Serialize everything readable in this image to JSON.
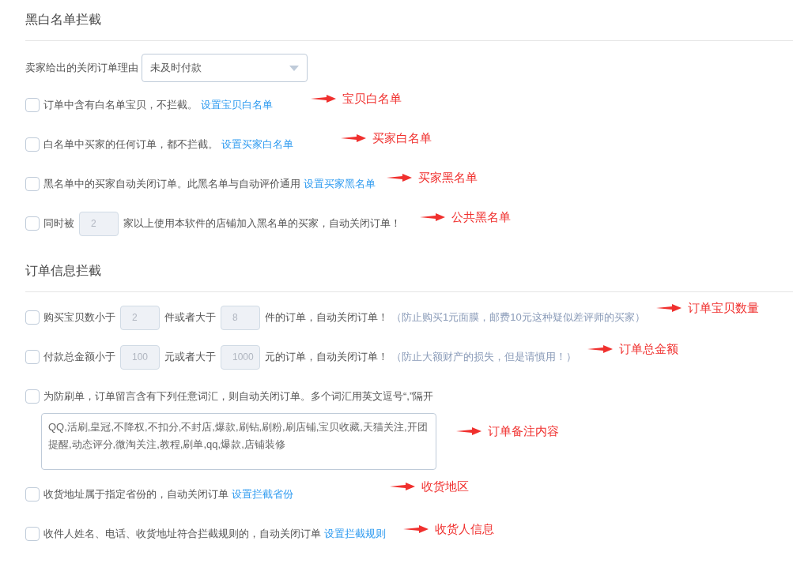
{
  "sections": [
    {
      "title": "黑白名单拦截",
      "reason_select": {
        "label": "卖家给出的关闭订单理由",
        "value": "未及时付款"
      },
      "rows": [
        {
          "checked": false,
          "parts": [
            {
              "kind": "text",
              "text": "订单中含有白名单宝贝，不拦截。"
            },
            {
              "kind": "link",
              "text": "设置宝贝白名单"
            }
          ],
          "annotation": "宝贝白名单"
        },
        {
          "checked": false,
          "parts": [
            {
              "kind": "text",
              "text": "白名单中买家的任何订单，都不拦截。"
            },
            {
              "kind": "link",
              "text": "设置买家白名单"
            }
          ],
          "annotation": "买家白名单"
        },
        {
          "checked": false,
          "parts": [
            {
              "kind": "text",
              "text": "黑名单中的买家自动关闭订单。此黑名单与自动评价通用"
            },
            {
              "kind": "link",
              "text": "设置买家黑名单"
            }
          ],
          "annotation": "买家黑名单"
        },
        {
          "checked": false,
          "parts": [
            {
              "kind": "text",
              "text": "同时被"
            },
            {
              "kind": "input",
              "text": "2"
            },
            {
              "kind": "text",
              "text": "家以上使用本软件的店铺加入黑名单的买家，自动关闭订单！"
            }
          ],
          "annotation": "公共黑名单"
        }
      ]
    },
    {
      "title": "订单信息拦截",
      "rows": [
        {
          "checked": false,
          "parts": [
            {
              "kind": "text",
              "text": "购买宝贝数小于"
            },
            {
              "kind": "input",
              "text": "2"
            },
            {
              "kind": "text",
              "text": "件或者大于"
            },
            {
              "kind": "input",
              "text": "8"
            },
            {
              "kind": "text",
              "text": "件的订单，自动关闭订单！"
            },
            {
              "kind": "hint",
              "text": "（防止购买1元面膜，邮费10元这种疑似差评师的买家）"
            }
          ],
          "annotation": "订单宝贝数量"
        },
        {
          "checked": false,
          "parts": [
            {
              "kind": "text",
              "text": "付款总金额小于"
            },
            {
              "kind": "input",
              "text": "100"
            },
            {
              "kind": "text",
              "text": "元或者大于"
            },
            {
              "kind": "input",
              "text": "1000"
            },
            {
              "kind": "text",
              "text": "元的订单，自动关闭订单！"
            },
            {
              "kind": "hint",
              "text": "（防止大额财产的损失，但是请慎用！）"
            }
          ],
          "annotation": "订单总金额"
        },
        {
          "checked": false,
          "parts": [
            {
              "kind": "text",
              "text": "为防刷单，订单留言含有下列任意词汇，则自动关闭订单。多个词汇用英文逗号“,”隔开"
            }
          ],
          "textarea": "QQ,活刷,皇冠,不降权,不扣分,不封店,爆款,刷钻,刷粉,刷店铺,宝贝收藏,天猫关注,开团提醒,动态评分,微淘关注,教程,刷单,qq,爆款,店铺装修",
          "annotation": "订单备注内容"
        },
        {
          "checked": false,
          "parts": [
            {
              "kind": "text",
              "text": "收货地址属于指定省份的，自动关闭订单"
            },
            {
              "kind": "link",
              "text": "设置拦截省份"
            }
          ],
          "annotation": "收货地区"
        },
        {
          "checked": false,
          "parts": [
            {
              "kind": "text",
              "text": "收件人姓名、电话、收货地址符合拦截规则的，自动关闭订单"
            },
            {
              "kind": "link",
              "text": "设置拦截规则"
            }
          ],
          "annotation": "收货人信息"
        }
      ]
    }
  ]
}
